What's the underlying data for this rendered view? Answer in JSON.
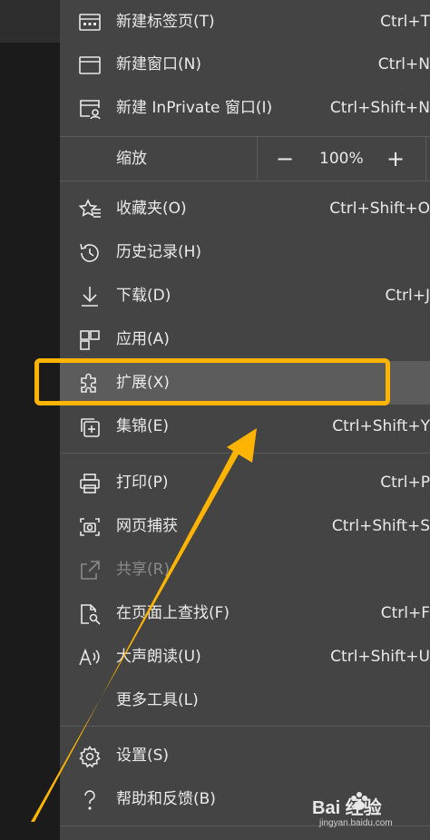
{
  "menu": {
    "items": [
      {
        "label": "新建标签页(T)",
        "shortcut": "Ctrl+T",
        "icon": "new-tab-icon"
      },
      {
        "label": "新建窗口(N)",
        "shortcut": "Ctrl+N",
        "icon": "new-window-icon"
      },
      {
        "label": "新建 InPrivate 窗口(I)",
        "shortcut": "Ctrl+Shift+N",
        "icon": "inprivate-window-icon"
      },
      {
        "label": "收藏夹(O)",
        "shortcut": "Ctrl+Shift+O",
        "icon": "favorites-star-icon"
      },
      {
        "label": "历史记录(H)",
        "shortcut": "",
        "icon": "history-icon"
      },
      {
        "label": "下载(D)",
        "shortcut": "Ctrl+J",
        "icon": "download-icon"
      },
      {
        "label": "应用(A)",
        "shortcut": "",
        "icon": "apps-icon"
      },
      {
        "label": "扩展(X)",
        "shortcut": "",
        "icon": "extensions-puzzle-icon"
      },
      {
        "label": "集锦(E)",
        "shortcut": "Ctrl+Shift+Y",
        "icon": "collections-icon"
      },
      {
        "label": "打印(P)",
        "shortcut": "Ctrl+P",
        "icon": "printer-icon"
      },
      {
        "label": "网页捕获",
        "shortcut": "Ctrl+Shift+S",
        "icon": "web-capture-icon"
      },
      {
        "label": "共享(R)",
        "shortcut": "",
        "icon": "share-icon"
      },
      {
        "label": "在页面上查找(F)",
        "shortcut": "Ctrl+F",
        "icon": "find-on-page-icon"
      },
      {
        "label": "大声朗读(U)",
        "shortcut": "Ctrl+Shift+U",
        "icon": "read-aloud-icon"
      },
      {
        "label": "更多工具(L)",
        "shortcut": "",
        "icon": ""
      },
      {
        "label": "设置(S)",
        "shortcut": "",
        "icon": "settings-gear-icon"
      },
      {
        "label": "帮助和反馈(B)",
        "shortcut": "",
        "icon": "help-question-icon"
      }
    ],
    "zoom": {
      "label": "缩放",
      "minus": "−",
      "value": "100%",
      "plus": "+"
    }
  },
  "colors": {
    "menu_bg": "#444444",
    "highlight_row": "#5c5c5c",
    "annotation": "#ffb400"
  },
  "watermark": {
    "text": "Bai 经验",
    "url": "jingyan.baidu.com"
  }
}
